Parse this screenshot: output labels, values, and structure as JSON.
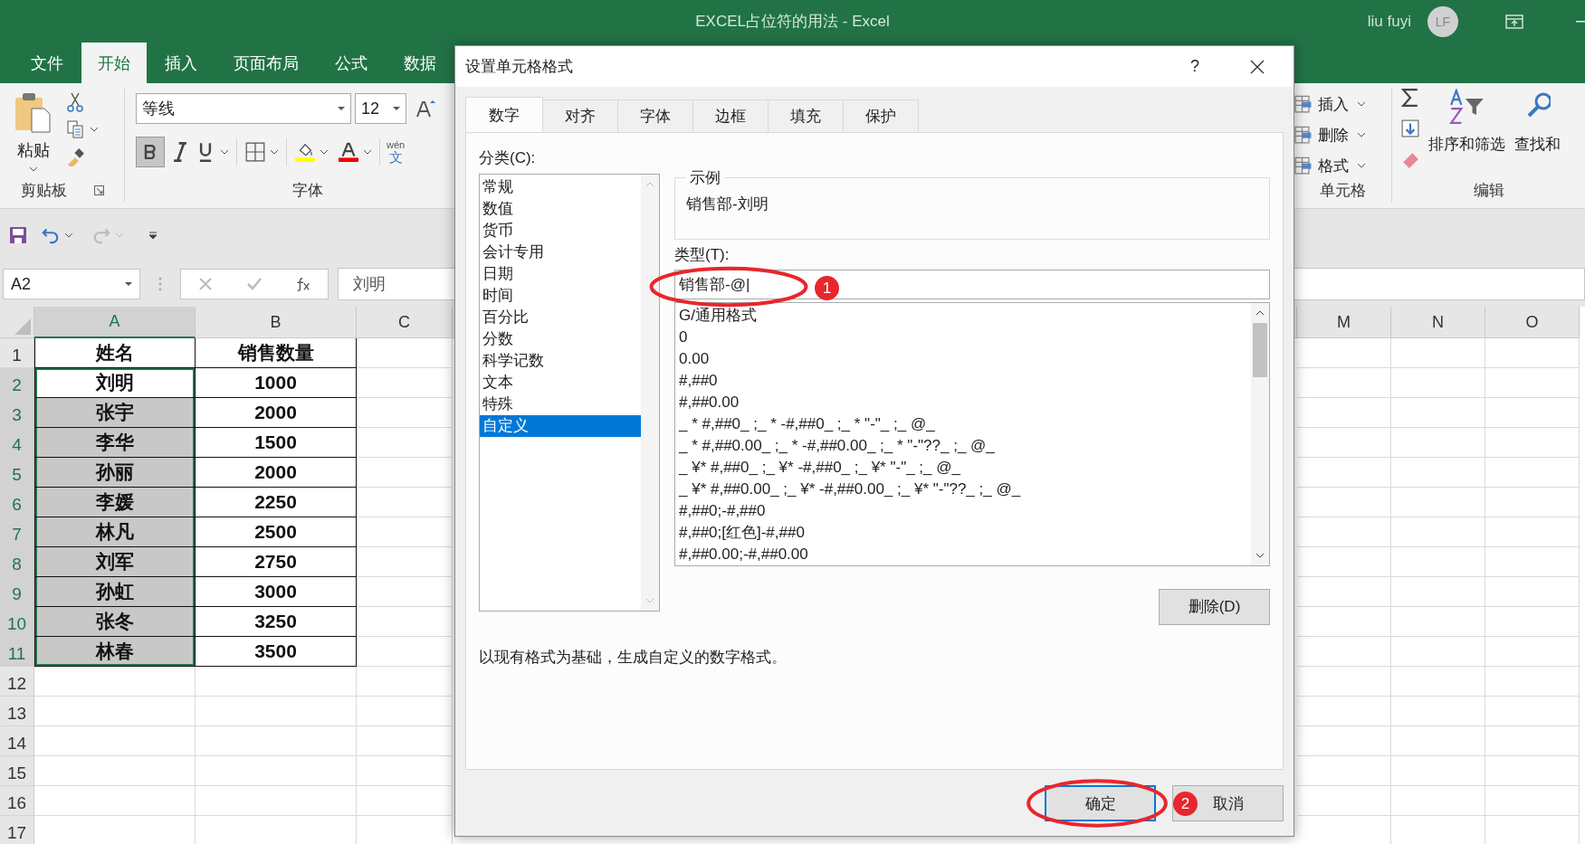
{
  "window": {
    "title": "EXCEL占位符的用法  -  Excel",
    "user": "liu fuyi",
    "avatar": "LF"
  },
  "ribbon_tabs": [
    {
      "label": "文件",
      "selected": false
    },
    {
      "label": "开始",
      "selected": true
    },
    {
      "label": "插入",
      "selected": false
    },
    {
      "label": "页面布局",
      "selected": false
    },
    {
      "label": "公式",
      "selected": false
    },
    {
      "label": "数据",
      "selected": false
    }
  ],
  "ribbon": {
    "clipboard": {
      "paste": "粘贴",
      "group": "剪贴板"
    },
    "font": {
      "name": "等线",
      "size": "12",
      "bold_pressed": true,
      "pinyin": "wén",
      "pinyin_char": "文",
      "group": "字体"
    },
    "cells": {
      "items": [
        "插入",
        "删除",
        "格式"
      ],
      "group": "单元格"
    },
    "editing": {
      "sort": "排序和筛选",
      "find": "查找和",
      "group": "编辑"
    }
  },
  "formula_bar": {
    "name_box": "A2",
    "content": "刘明"
  },
  "sheet": {
    "columns": [
      {
        "label": "A",
        "selected": true
      },
      {
        "label": "B",
        "selected": false
      },
      {
        "label": "C",
        "selected": false
      },
      {
        "label": "M",
        "selected": false
      },
      {
        "label": "N",
        "selected": false
      },
      {
        "label": "O",
        "selected": false
      }
    ],
    "rows": [
      {
        "number": "1",
        "cells": [
          "姓名",
          "销售数量"
        ],
        "selected": false,
        "active": false
      },
      {
        "number": "2",
        "cells": [
          "刘明",
          "1000"
        ],
        "selected": true,
        "active": true
      },
      {
        "number": "3",
        "cells": [
          "张宇",
          "2000"
        ],
        "selected": true,
        "active": false
      },
      {
        "number": "4",
        "cells": [
          "李华",
          "1500"
        ],
        "selected": true,
        "active": false
      },
      {
        "number": "5",
        "cells": [
          "孙丽",
          "2000"
        ],
        "selected": true,
        "active": false
      },
      {
        "number": "6",
        "cells": [
          "李媛",
          "2250"
        ],
        "selected": true,
        "active": false
      },
      {
        "number": "7",
        "cells": [
          "林凡",
          "2500"
        ],
        "selected": true,
        "active": false
      },
      {
        "number": "8",
        "cells": [
          "刘军",
          "2750"
        ],
        "selected": true,
        "active": false
      },
      {
        "number": "9",
        "cells": [
          "孙虹",
          "3000"
        ],
        "selected": true,
        "active": false
      },
      {
        "number": "10",
        "cells": [
          "张冬",
          "3250"
        ],
        "selected": true,
        "active": false
      },
      {
        "number": "11",
        "cells": [
          "林春",
          "3500"
        ],
        "selected": true,
        "active": false
      },
      {
        "number": "12",
        "selected": false
      },
      {
        "number": "13",
        "selected": false
      },
      {
        "number": "14",
        "selected": false
      },
      {
        "number": "15",
        "selected": false
      },
      {
        "number": "16",
        "selected": false
      },
      {
        "number": "17",
        "selected": false
      }
    ]
  },
  "dialog": {
    "title": "设置单元格格式",
    "help": "?",
    "tabs": [
      {
        "label": "数字",
        "selected": true
      },
      {
        "label": "对齐",
        "selected": false
      },
      {
        "label": "字体",
        "selected": false
      },
      {
        "label": "边框",
        "selected": false
      },
      {
        "label": "填充",
        "selected": false
      },
      {
        "label": "保护",
        "selected": false
      }
    ],
    "category_label": "分类(C):",
    "categories": [
      {
        "label": "常规",
        "selected": false
      },
      {
        "label": "数值",
        "selected": false
      },
      {
        "label": "货币",
        "selected": false
      },
      {
        "label": "会计专用",
        "selected": false
      },
      {
        "label": "日期",
        "selected": false
      },
      {
        "label": "时间",
        "selected": false
      },
      {
        "label": "百分比",
        "selected": false
      },
      {
        "label": "分数",
        "selected": false
      },
      {
        "label": "科学记数",
        "selected": false
      },
      {
        "label": "文本",
        "selected": false
      },
      {
        "label": "特殊",
        "selected": false
      },
      {
        "label": "自定义",
        "selected": true
      }
    ],
    "sample_label": "示例",
    "sample": "销售部-刘明",
    "type_label": "类型(T):",
    "type_value": "销售部-@|",
    "formats": [
      "G/通用格式",
      "0",
      "0.00",
      "#,##0",
      "#,##0.00",
      "_ * #,##0_ ;_ * -#,##0_ ;_ * \"-\"_ ;_ @_",
      "_ * #,##0.00_ ;_ * -#,##0.00_ ;_ * \"-\"??_ ;_ @_",
      "_ ¥* #,##0_ ;_ ¥* -#,##0_ ;_ ¥* \"-\"_ ;_ @_",
      "_ ¥* #,##0.00_ ;_ ¥* -#,##0.00_ ;_ ¥* \"-\"??_ ;_ @_",
      "#,##0;-#,##0",
      "#,##0;[红色]-#,##0",
      "#,##0.00;-#,##0.00"
    ],
    "delete_button": "删除(D)",
    "description": "以现有格式为基础，生成自定义的数字格式。",
    "ok_button": "确定",
    "cancel_button": "取消"
  },
  "annotations": [
    {
      "number": "1"
    },
    {
      "number": "2"
    }
  ]
}
